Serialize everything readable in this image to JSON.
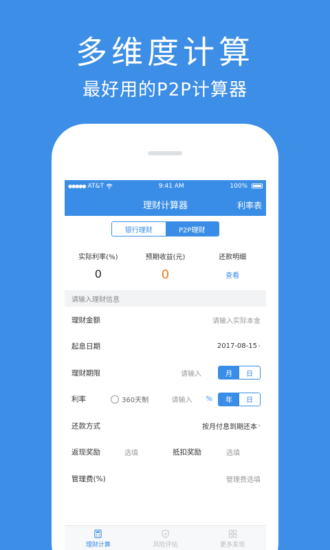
{
  "promo": {
    "title": "多维度计算",
    "subtitle": "最好用的P2P计算器"
  },
  "status_bar": {
    "carrier": "AT&T",
    "time": "9:41 AM",
    "battery": "100%"
  },
  "nav": {
    "title": "理财计算器",
    "right": "利率表"
  },
  "segment": {
    "options": [
      "银行理财",
      "P2P理财"
    ],
    "selected": "P2P理财"
  },
  "stats": [
    {
      "label": "实际利率(%)",
      "value": "0"
    },
    {
      "label": "预期收益(元)",
      "value": "0"
    },
    {
      "label": "还款明细",
      "link": "查看"
    }
  ],
  "section_header": "请输入理财信息",
  "form": {
    "amount": {
      "label": "理财金额",
      "placeholder": "请输入实际本金"
    },
    "start_date": {
      "label": "起息日期",
      "value": "2017-08-15"
    },
    "term": {
      "label": "理财期限",
      "placeholder": "请输入",
      "units": [
        "月",
        "日"
      ],
      "selected": "月"
    },
    "rate": {
      "label": "利率",
      "radio": "360天制",
      "placeholder": "请输入",
      "unit": "%",
      "units": [
        "年",
        "日"
      ],
      "selected": "年"
    },
    "repay": {
      "label": "还款方式",
      "value": "按月付息到期还本"
    },
    "cashback": {
      "label": "返现奖励",
      "placeholder": "选填"
    },
    "deduction": {
      "label": "抵扣奖励",
      "placeholder": "选填"
    },
    "fee": {
      "label": "管理费(%)",
      "placeholder": "管理费选填"
    }
  },
  "tabbar": [
    {
      "label": "理财计算",
      "icon": "calculator-icon",
      "active": true
    },
    {
      "label": "风险评估",
      "icon": "shield-icon",
      "active": false
    },
    {
      "label": "更多发现",
      "icon": "grid-icon",
      "active": false
    }
  ],
  "colors": {
    "brand": "#3a8de6",
    "background": "#3d8ee6",
    "accent_orange": "#f07a1a"
  }
}
